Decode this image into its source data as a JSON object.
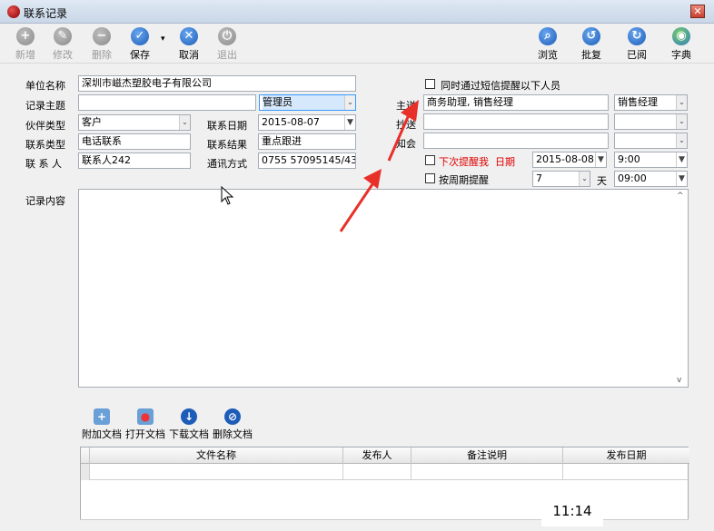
{
  "window": {
    "title": "联系记录",
    "close_glyph": "✕"
  },
  "toolbar": {
    "left": [
      {
        "label": "新增",
        "icon": "plus-icon",
        "glyph": "+",
        "enabled": false
      },
      {
        "label": "修改",
        "icon": "edit-icon",
        "glyph": "✎",
        "enabled": false
      },
      {
        "label": "删除",
        "icon": "minus-icon",
        "glyph": "−",
        "enabled": false
      },
      {
        "label": "保存",
        "icon": "check-icon",
        "glyph": "✓",
        "enabled": true
      },
      {
        "label": "取消",
        "icon": "x-icon",
        "glyph": "✕",
        "enabled": true
      },
      {
        "label": "退出",
        "icon": "exit-icon",
        "glyph": "⏻",
        "enabled": false
      }
    ],
    "right": [
      {
        "label": "浏览",
        "icon": "magnifier-icon",
        "glyph": "⌕"
      },
      {
        "label": "批复",
        "icon": "reply-icon",
        "glyph": "↺"
      },
      {
        "label": "已阅",
        "icon": "read-icon",
        "glyph": "↻"
      },
      {
        "label": "字典",
        "icon": "globe-icon",
        "glyph": "◉"
      }
    ],
    "save_dropdown_glyph": "▾"
  },
  "form": {
    "company_label": "单位名称",
    "company_value": "深圳市嵫杰塑胶电子有限公司",
    "subject_label": "记录主题",
    "subject_value": "",
    "owner_value": "管理员",
    "partner_type_label": "伙伴类型",
    "partner_type_value": "客户",
    "contact_date_label": "联系日期",
    "contact_date_value": "2015-08-07",
    "contact_type_label": "联系类型",
    "contact_type_value": "电话联系",
    "contact_result_label": "联系结果",
    "contact_result_value": "重点跟进",
    "contact_person_label": "联 系 人",
    "contact_person_value": "联系人242",
    "comm_label": "通讯方式",
    "comm_value": "0755 57095145/43",
    "content_label": "记录内容",
    "content_value": ""
  },
  "notify": {
    "sms_label": "同时通过短信提醒以下人员",
    "main_label": "主送",
    "main_value": "商务助理, 销售经理",
    "main_role": "销售经理",
    "cc_label": "抄送",
    "cc_value": "",
    "cc_role": "",
    "sign_label": "知会",
    "sign_value": "",
    "sign_role": "",
    "next_remind_label": "下次提醒我",
    "date_label": "日期",
    "remind_date": "2015-08-08",
    "remind_time": "9:00",
    "period_label": "按周期提醒",
    "period_days": "7",
    "day_label": "天",
    "period_time": "09:00"
  },
  "documents": {
    "buttons": [
      {
        "label": "附加文档",
        "icon": "attach-doc-icon",
        "glyph": "+"
      },
      {
        "label": "打开文档",
        "icon": "open-doc-icon",
        "glyph": "●"
      },
      {
        "label": "下载文档",
        "icon": "download-icon",
        "glyph": "↓"
      },
      {
        "label": "删除文档",
        "icon": "delete-doc-icon",
        "glyph": "⊘"
      }
    ],
    "columns": [
      "文件名称",
      "发布人",
      "备注说明",
      "发布日期"
    ]
  },
  "clock": "11:14",
  "glyphs": {
    "combo_arrow": "▼",
    "combo_arrow_light": "⌄",
    "scroll_up": "^",
    "scroll_down": "v"
  },
  "colors": {
    "accent_blue": "#1d5cb8",
    "remind_red": "#e00000",
    "arrow_red": "#e8302a",
    "selection": "#3399ff"
  }
}
